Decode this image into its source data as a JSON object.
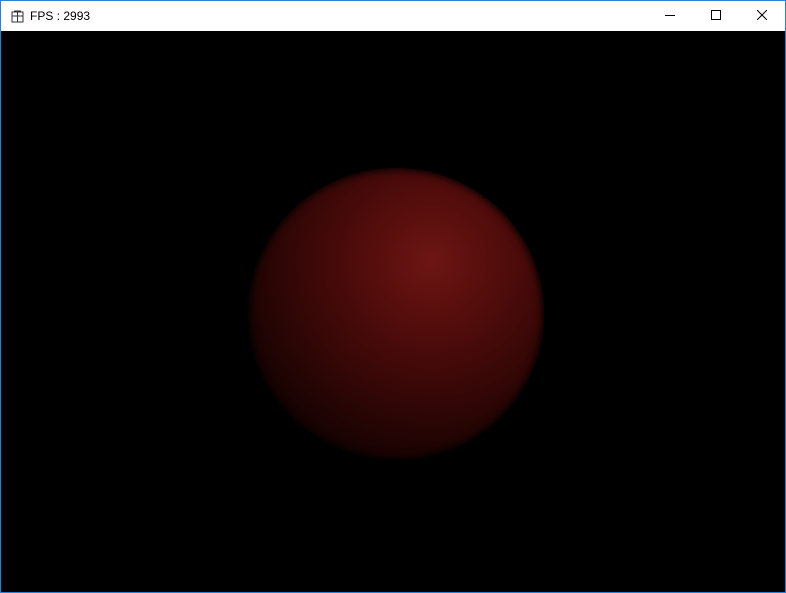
{
  "window": {
    "title": "FPS : 2993",
    "app_icon": "app-window-icon",
    "controls": {
      "minimize_icon": "minimize-icon",
      "maximize_icon": "maximize-icon",
      "close_icon": "close-icon"
    },
    "border_color": "#2b7fd4"
  },
  "scene": {
    "background_color": "#000000",
    "object": "sphere",
    "sphere_color": "#6d1614"
  }
}
